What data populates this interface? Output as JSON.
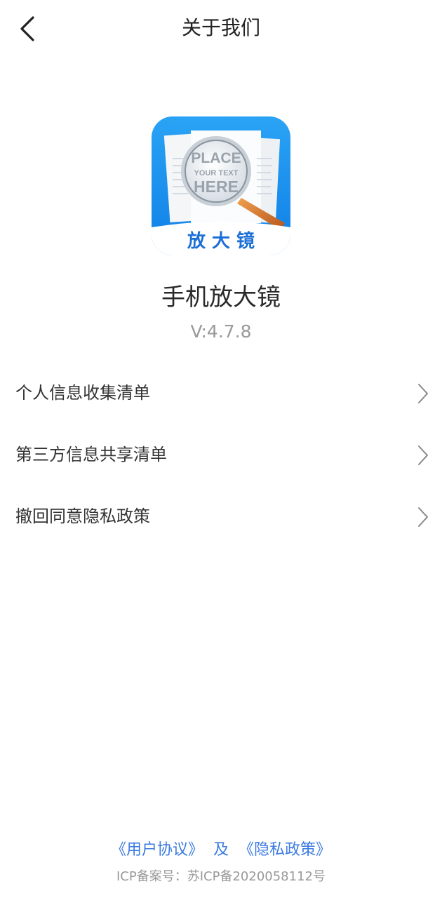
{
  "header": {
    "title": "关于我们",
    "back_icon": "back-arrow-icon"
  },
  "app": {
    "logo_text": "放 大 镜",
    "logo_lens_text": [
      "PLACE",
      "YOUR TEXT",
      "HERE"
    ],
    "name": "手机放大镜",
    "version": "V:4.7.8"
  },
  "menu": {
    "items": [
      {
        "label": "个人信息收集清单",
        "icon": "chevron-right-icon"
      },
      {
        "label": "第三方信息共享清单",
        "icon": "chevron-right-icon"
      },
      {
        "label": "撤回同意隐私政策",
        "icon": "chevron-right-icon"
      }
    ]
  },
  "footer": {
    "user_agreement": "《用户协议》",
    "and_text": "及",
    "privacy_policy": "《隐私政策》",
    "icp": "ICP备案号：苏ICP备2020058112号"
  },
  "colors": {
    "link": "#3b7be0",
    "logo_blue": "#1a8ef0",
    "logo_text": "#1b6fd6",
    "handle": "#d9772a"
  }
}
